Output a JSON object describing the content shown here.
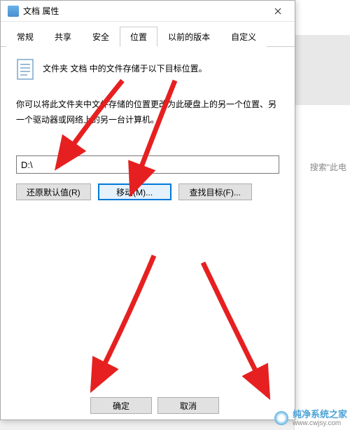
{
  "dialog": {
    "title": "文档 属性",
    "tabs": [
      "常规",
      "共享",
      "安全",
      "位置",
      "以前的版本",
      "自定义"
    ],
    "activeTab": "位置",
    "infoText": "文件夹 文档 中的文件存储于以下目标位置。",
    "descText": "你可以将此文件夹中文件存储的位置更改为此硬盘上的另一个位置、另一个驱动器或网络上的另一台计算机。",
    "pathValue": "D:\\",
    "buttons": {
      "restore": "还原默认值(R)",
      "move": "移动(M)...",
      "find": "查找目标(F)..."
    },
    "bottom": {
      "ok": "确定",
      "cancel": "取消"
    }
  },
  "background": {
    "searchHint": "搜索\"此电"
  },
  "watermark": {
    "name": "纯净系统之家",
    "url": "www.cwjsy.com"
  }
}
